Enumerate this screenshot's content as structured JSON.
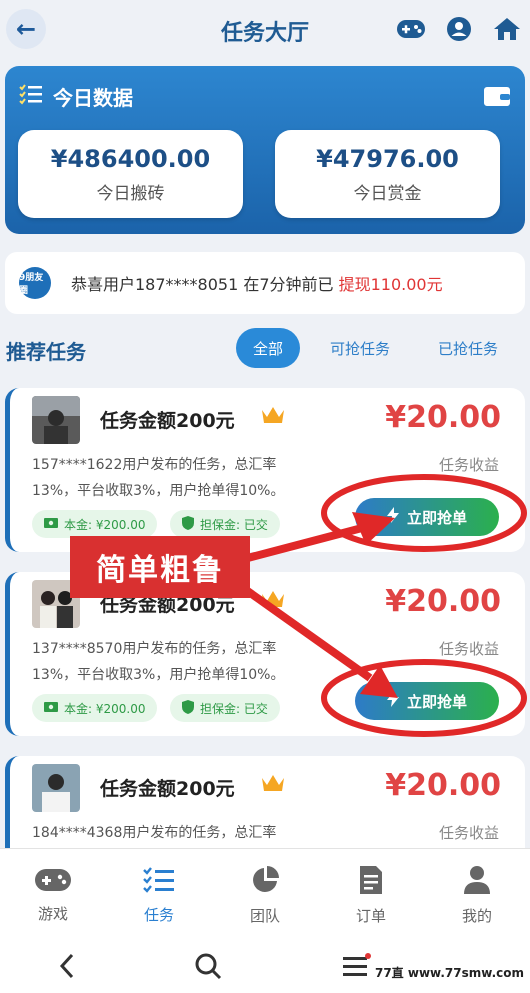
{
  "header": {
    "title": "任务大厅"
  },
  "stats": {
    "heading": "今日数据",
    "items": [
      {
        "value": "¥486400.00",
        "label": "今日搬砖"
      },
      {
        "value": "¥47976.00",
        "label": "今日赏金"
      }
    ]
  },
  "notice": {
    "icon_text": "9朋友圈",
    "text": "恭喜用户187****8051 在7分钟前已",
    "highlight": "提现110.00元"
  },
  "section": {
    "title": "推荐任务",
    "tabs": [
      "全部",
      "可抢任务",
      "已抢任务"
    ]
  },
  "tasks": [
    {
      "title": "任务金额200元",
      "reward": "¥20.00",
      "reward_label": "任务收益",
      "desc_line1": "157****1622用户发布的任务，总汇率",
      "desc_line2": "13%，平台收取3%，用户抢单得10%。",
      "chip1": "本金: ¥200.00",
      "chip2": "担保金: 已交",
      "button": "立即抢单"
    },
    {
      "title": "任务金额200元",
      "reward": "¥20.00",
      "reward_label": "任务收益",
      "desc_line1": "137****8570用户发布的任务，总汇率",
      "desc_line2": "13%，平台收取3%，用户抢单得10%。",
      "chip1": "本金: ¥200.00",
      "chip2": "担保金: 已交",
      "button": "立即抢单"
    },
    {
      "title": "任务金额200元",
      "reward": "¥20.00",
      "reward_label": "任务收益",
      "desc_line1": "184****4368用户发布的任务，总汇率"
    }
  ],
  "annotation": {
    "label": "简单粗鲁"
  },
  "bottom_nav": [
    {
      "label": "游戏",
      "icon": "gamepad-icon"
    },
    {
      "label": "任务",
      "icon": "task-list-icon"
    },
    {
      "label": "团队",
      "icon": "pie-chart-icon"
    },
    {
      "label": "订单",
      "icon": "order-icon"
    },
    {
      "label": "我的",
      "icon": "user-icon"
    }
  ],
  "watermark": "77直  www.77smw.com",
  "colors": {
    "primary": "#1f5b93",
    "accent": "#2a8ad8",
    "reward": "#e04444",
    "annotation": "#d93030"
  }
}
